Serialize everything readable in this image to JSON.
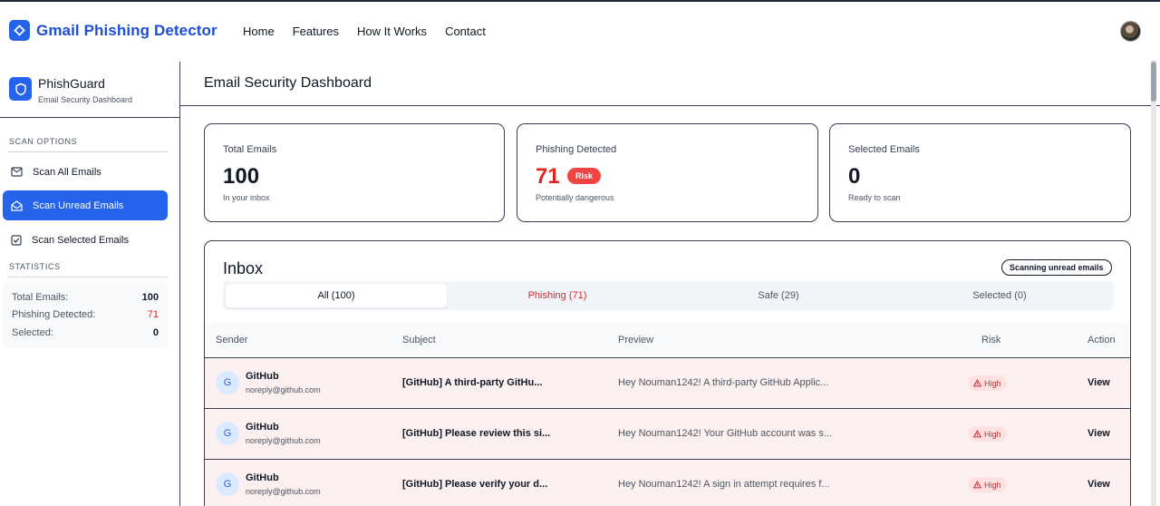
{
  "app": {
    "title": "Gmail Phishing Detector"
  },
  "nav": {
    "links": [
      "Home",
      "Features",
      "How It Works",
      "Contact"
    ]
  },
  "sidebar": {
    "title": "PhishGuard",
    "subtitle": "Email Security Dashboard",
    "scan_options_heading": "SCAN OPTIONS",
    "items": [
      {
        "label": "Scan All Emails",
        "icon": "mail-icon",
        "active": false
      },
      {
        "label": "Scan Unread Emails",
        "icon": "mail-open-icon",
        "active": true
      },
      {
        "label": "Scan Selected Emails",
        "icon": "checkbox-icon",
        "active": false
      }
    ],
    "statistics_heading": "STATISTICS",
    "stats": [
      {
        "label": "Total Emails:",
        "value": "100"
      },
      {
        "label": "Phishing Detected:",
        "value": "71"
      },
      {
        "label": "Selected:",
        "value": "0"
      }
    ]
  },
  "main": {
    "title": "Email Security Dashboard",
    "cards": [
      {
        "label": "Total Emails",
        "value": "100",
        "sub": "In your inbox"
      },
      {
        "label": "Phishing Detected",
        "value": "71",
        "badge": "Risk",
        "sub": "Potentially dangerous"
      },
      {
        "label": "Selected Emails",
        "value": "0",
        "sub": "Ready to scan"
      }
    ]
  },
  "inbox": {
    "title": "Inbox",
    "status_badge": "Scanning unread emails",
    "tabs": [
      "All (100)",
      "Phishing (71)",
      "Safe (29)",
      "Selected (0)"
    ],
    "columns": [
      "Sender",
      "Subject",
      "Preview",
      "Risk",
      "Action"
    ],
    "rows": [
      {
        "initial": "G",
        "sender": "GitHub",
        "email": "noreply@github.com",
        "subject": "[GitHub] A third-party GitHu...",
        "preview": "Hey Nouman1242! A third-party GitHub Applic...",
        "risk": "High",
        "action": "View"
      },
      {
        "initial": "G",
        "sender": "GitHub",
        "email": "noreply@github.com",
        "subject": "[GitHub] Please review this si...",
        "preview": "Hey Nouman1242! Your GitHub account was s...",
        "risk": "High",
        "action": "View"
      },
      {
        "initial": "G",
        "sender": "GitHub",
        "email": "noreply@github.com",
        "subject": "[GitHub] Please verify your d...",
        "preview": "Hey Nouman1242! A sign in attempt requires f...",
        "risk": "High",
        "action": "View"
      }
    ]
  },
  "colors": {
    "accent": "#2563eb",
    "danger": "#dc2626",
    "phishing_row_bg": "#fdf0f0"
  }
}
